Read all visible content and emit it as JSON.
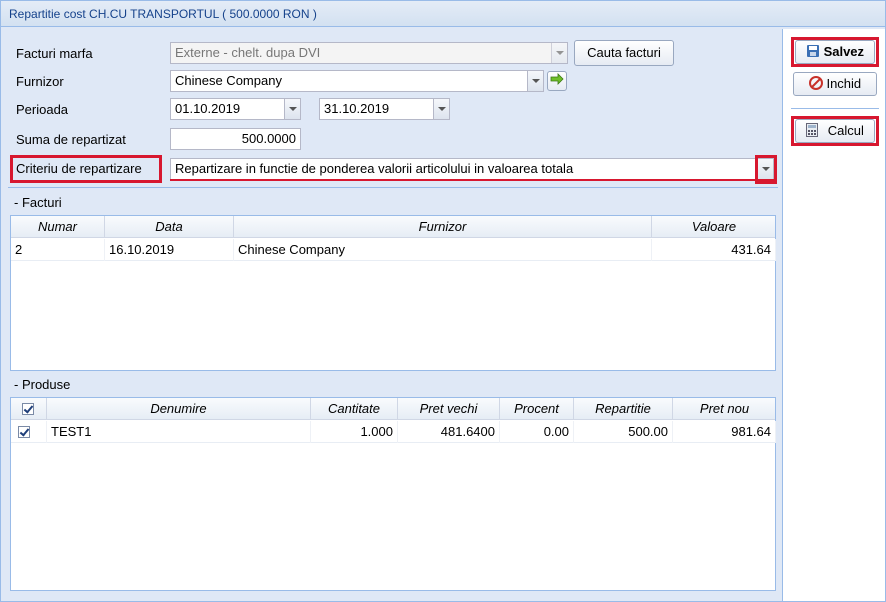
{
  "window": {
    "title": "Repartitie cost CH.CU TRANSPORTUL ( 500.0000 RON )"
  },
  "form": {
    "facturi_marfa_label": "Facturi marfa",
    "facturi_marfa_value": "Externe - chelt. dupa DVI",
    "cauta_facturi_label": "Cauta facturi",
    "furnizor_label": "Furnizor",
    "furnizor_value": "Chinese Company",
    "perioada_label": "Perioada",
    "perioada_from": "01.10.2019",
    "perioada_to": "31.10.2019",
    "suma_label": "Suma de repartizat",
    "suma_value": "500.0000",
    "criteriu_label": "Criteriu de repartizare",
    "criteriu_value": "Repartizare in functie de ponderea valorii articolului in valoarea totala"
  },
  "facturi": {
    "section_title": "- Facturi",
    "columns": [
      "Numar",
      "Data",
      "Furnizor",
      "Valoare"
    ],
    "rows": [
      {
        "numar": "2",
        "data": "16.10.2019",
        "furnizor": "Chinese Company",
        "valoare": "431.64"
      }
    ]
  },
  "produse": {
    "section_title": "- Produse",
    "columns": [
      "Denumire",
      "Cantitate",
      "Pret vechi",
      "Procent",
      "Repartitie",
      "Pret nou"
    ],
    "rows": [
      {
        "denumire": "TEST1",
        "cantitate": "1.000",
        "pret_vechi": "481.6400",
        "procent": "0.00",
        "repartitie": "500.00",
        "pret_nou": "981.64"
      }
    ]
  },
  "actions": {
    "salvez_label": "Salvez",
    "inchid_label": "Inchid",
    "calcul_label": "Calcul"
  },
  "colors": {
    "highlight": "#d7172f",
    "border": "#99bbe8",
    "title_text": "#15428b"
  }
}
